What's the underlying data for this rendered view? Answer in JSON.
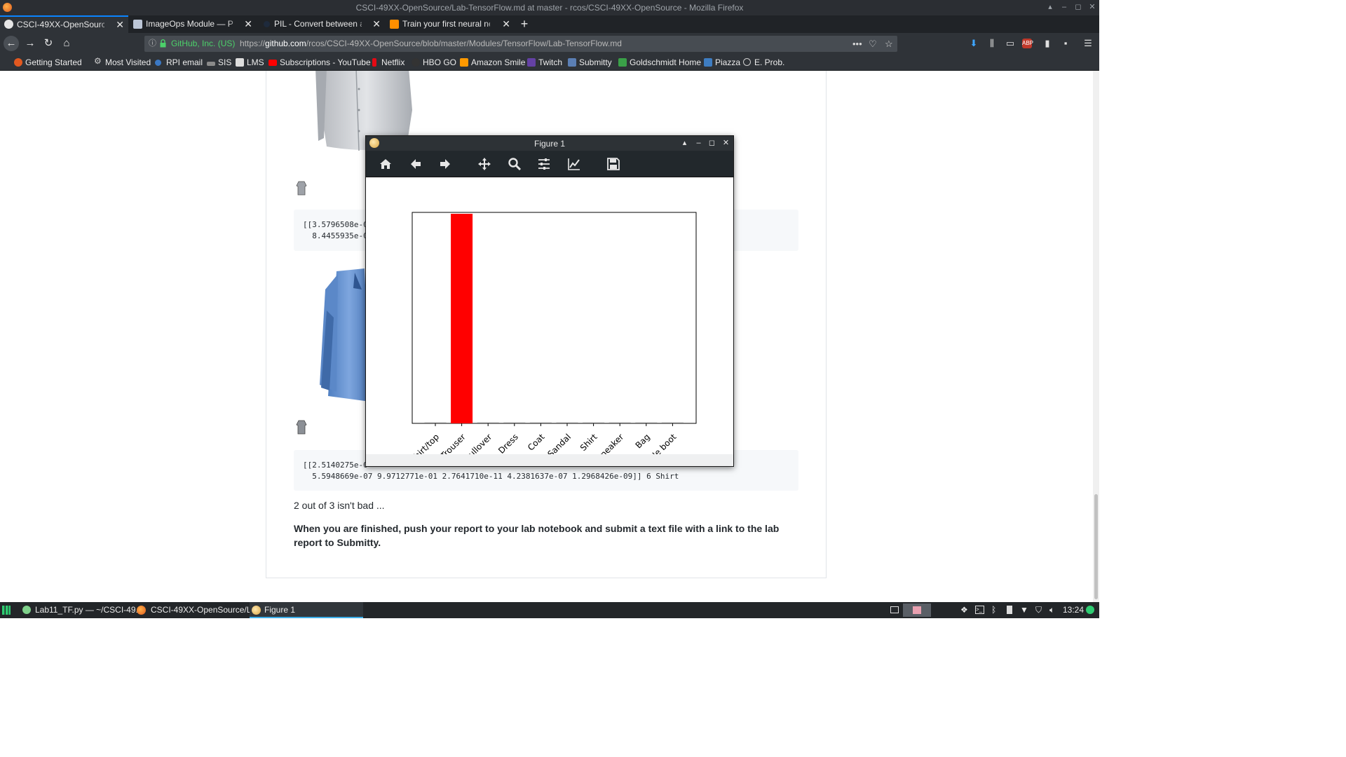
{
  "window": {
    "title": "CSCI-49XX-OpenSource/Lab-TensorFlow.md at master - rcos/CSCI-49XX-OpenSource - Mozilla Firefox"
  },
  "tabs": [
    {
      "label": "CSCI-49XX-OpenSource/La",
      "active": true
    },
    {
      "label": "ImageOps Module — Pillo",
      "active": false
    },
    {
      "label": "PIL - Convert between a Pi",
      "active": false
    },
    {
      "label": "Train your first neural netw",
      "active": false
    }
  ],
  "urlbar": {
    "identity": "GitHub, Inc. (US)",
    "url_prefix": "https://",
    "url_host": "github.com",
    "url_path": "/rcos/CSCI-49XX-OpenSource/blob/master/Modules/TensorFlow/Lab-TensorFlow.md"
  },
  "bookmarks": [
    {
      "label": "Getting Started",
      "color": "#e25920"
    },
    {
      "label": "Most Visited",
      "color": "#cfcfcf"
    },
    {
      "label": "RPI email",
      "color": "#3b78c4"
    },
    {
      "label": "SIS",
      "color": "#8a8a8a"
    },
    {
      "label": "LMS",
      "color": "#dddddd"
    },
    {
      "label": "Subscriptions - YouTube",
      "color": "#ff0000"
    },
    {
      "label": "Netflix",
      "color": "#e50914"
    },
    {
      "label": "HBO GO",
      "color": "#333333"
    },
    {
      "label": "Amazon Smile",
      "color": "#ff9900"
    },
    {
      "label": "Twitch",
      "color": "#6441a5"
    },
    {
      "label": "Submitty",
      "color": "#5b7fb5"
    },
    {
      "label": "Goldschmidt Home",
      "color": "#3aa048"
    },
    {
      "label": "Piazza",
      "color": "#3e7dc2"
    },
    {
      "label": "E. Prob.",
      "color": "#cfcfcf"
    }
  ],
  "content": {
    "code1_line1": "[[3.5796508e-0",
    "code1_line2": "  8.4455935e-0",
    "code2_line1": "[[2.5140275e-0",
    "code2_line2": "  5.5948669e-07 9.9712771e-01 2.7641710e-11 4.2381637e-07 1.2968426e-09]] 6 Shirt",
    "para1": "2 out of 3 isn't bad ...",
    "para2": "When you are finished, push your report to your lab notebook and submit a text file with a link to the lab report to Submitty."
  },
  "figure": {
    "title": "Figure 1",
    "tools": [
      "home-icon",
      "back-arrow-icon",
      "forward-arrow-icon",
      "pan-icon",
      "zoom-icon",
      "subplots-icon",
      "edit-axes-icon",
      "save-icon"
    ]
  },
  "chart_data": {
    "type": "bar",
    "categories": [
      "T-shirt/top",
      "Trouser",
      "Pullover",
      "Dress",
      "Coat",
      "Sandal",
      "Shirt",
      "Sneaker",
      "Bag",
      "Ankle boot"
    ],
    "values": [
      0.0,
      1.0,
      0.0,
      0.0,
      0.0,
      0.0,
      0.0,
      0.0,
      0.0,
      0.0
    ],
    "bar_colors": [
      "#777777",
      "#ff0000",
      "#777777",
      "#777777",
      "#777777",
      "#777777",
      "#777777",
      "#777777",
      "#777777",
      "#777777"
    ],
    "ylim": [
      0,
      1
    ],
    "title": "",
    "xlabel": "",
    "ylabel": "",
    "grid": false
  },
  "taskbar": {
    "items": [
      {
        "label": "Lab11_TF.py — ~/CSCI-49..."
      },
      {
        "label": "CSCI-49XX-OpenSource/L..."
      },
      {
        "label": "Figure 1"
      }
    ],
    "clock": "13:24"
  }
}
